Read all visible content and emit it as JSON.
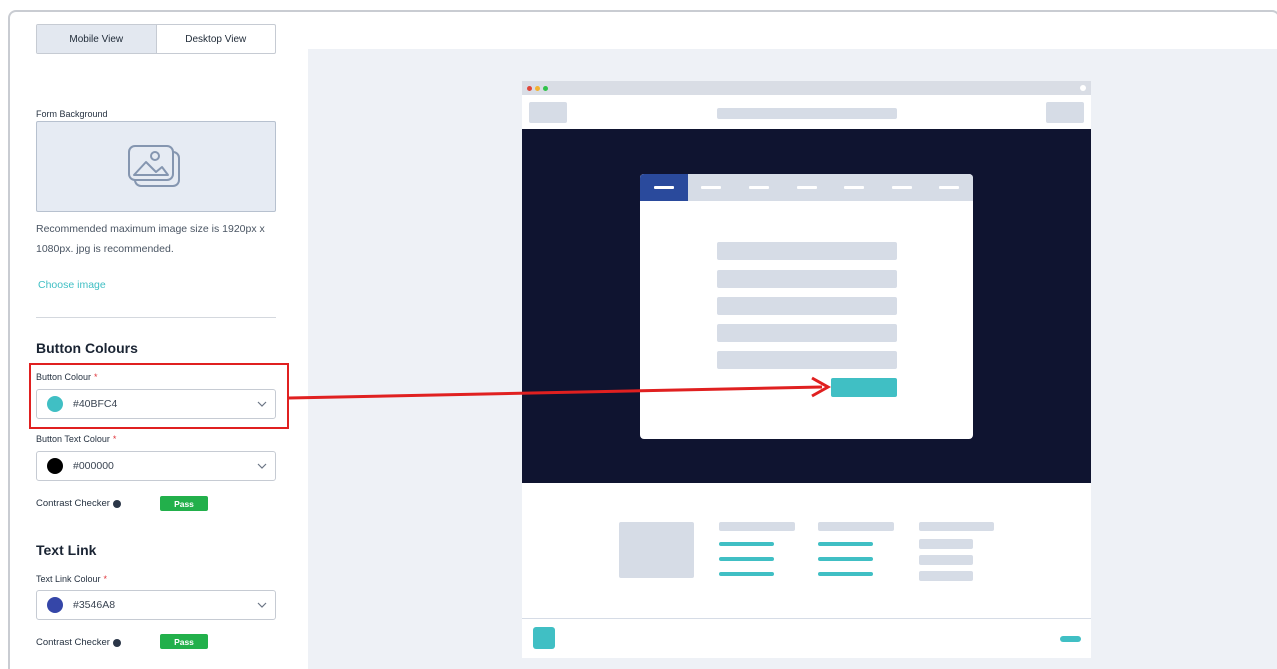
{
  "view_toggle": {
    "mobile_label": "Mobile View",
    "desktop_label": "Desktop View",
    "active": "mobile"
  },
  "form_background": {
    "label": "Form Background",
    "note": "Recommended maximum image size is 1920px x 1080px. jpg is recommended.",
    "choose_label": "Choose image"
  },
  "button_colours": {
    "heading": "Button Colours",
    "button_colour": {
      "label": "Button Colour",
      "required": "*",
      "value": "#40BFC4",
      "swatch": "#40bfc4"
    },
    "button_text_colour": {
      "label": "Button Text Colour",
      "required": "*",
      "value": "#000000",
      "swatch": "#000000"
    },
    "contrast_label": "Contrast Checker",
    "contrast_result": "Pass"
  },
  "text_link": {
    "heading": "Text Link",
    "text_link_colour": {
      "label": "Text Link Colour",
      "required": "*",
      "value": "#3546A8",
      "swatch": "#3546a8"
    },
    "contrast_label": "Contrast Checker",
    "contrast_result": "Pass"
  },
  "colors": {
    "accent": "#40bfc4",
    "pass": "#22b04b",
    "hero": "#0f1430",
    "annotation": "#e02020",
    "active_tab": "#2a4a9c"
  }
}
